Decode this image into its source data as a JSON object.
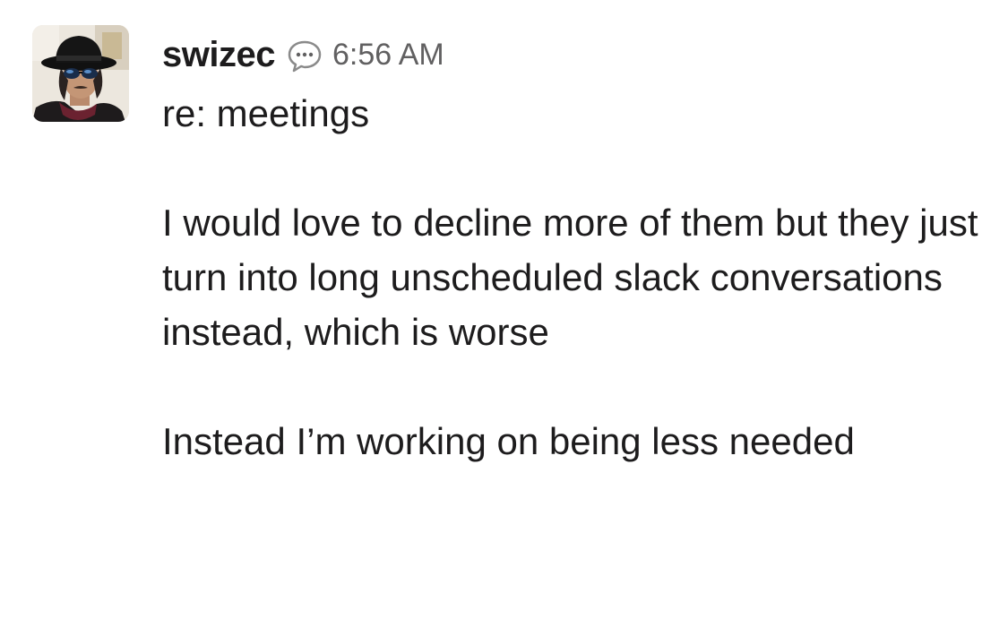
{
  "message": {
    "author": "swizec",
    "status_icon": "speech-bubble-icon",
    "timestamp": "6:56 AM",
    "subject": "re: meetings",
    "paragraph_1": "I would love to decline more of them but they just turn into long unscheduled slack conversations instead, which is worse",
    "paragraph_2": "Instead I’m working on being less needed"
  },
  "colors": {
    "text": "#1d1c1d",
    "timestamp": "#616061",
    "background": "#ffffff"
  }
}
